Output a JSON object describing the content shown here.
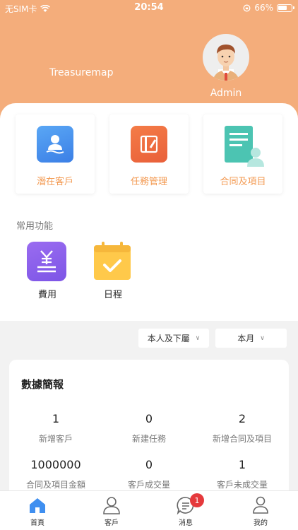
{
  "status_bar": {
    "carrier": "无SIM卡",
    "time": "20:54",
    "battery": "66%"
  },
  "header": {
    "app_name": "Treasuremap",
    "user_name": "Admin"
  },
  "quick_actions": [
    {
      "label": "潛在客戶",
      "icon": "customer-icon"
    },
    {
      "label": "任務管理",
      "icon": "task-icon"
    },
    {
      "label": "合同及項目",
      "icon": "contract-icon"
    }
  ],
  "common_functions": {
    "title": "常用功能",
    "items": [
      {
        "label": "費用",
        "icon": "expense-icon"
      },
      {
        "label": "日程",
        "icon": "schedule-icon"
      }
    ]
  },
  "filters": {
    "scope": "本人及下屬",
    "period": "本月"
  },
  "stats": {
    "title": "數據簡報",
    "items": [
      {
        "value": "1",
        "label": "新增客戶"
      },
      {
        "value": "0",
        "label": "新建任務"
      },
      {
        "value": "2",
        "label": "新增合同及項目"
      },
      {
        "value": "1000000",
        "label": "合同及項目金額"
      },
      {
        "value": "0",
        "label": "客戶成交量"
      },
      {
        "value": "1",
        "label": "客戶未成交量"
      }
    ]
  },
  "tabbar": {
    "items": [
      {
        "label": "首頁",
        "icon": "home-icon",
        "active": true
      },
      {
        "label": "客戶",
        "icon": "person-icon"
      },
      {
        "label": "消息",
        "icon": "message-icon",
        "badge": "1"
      },
      {
        "label": "我的",
        "icon": "profile-icon"
      }
    ]
  },
  "colors": {
    "header": "#f4ad7b",
    "accent": "#f39a52",
    "badge": "#e5393c"
  }
}
